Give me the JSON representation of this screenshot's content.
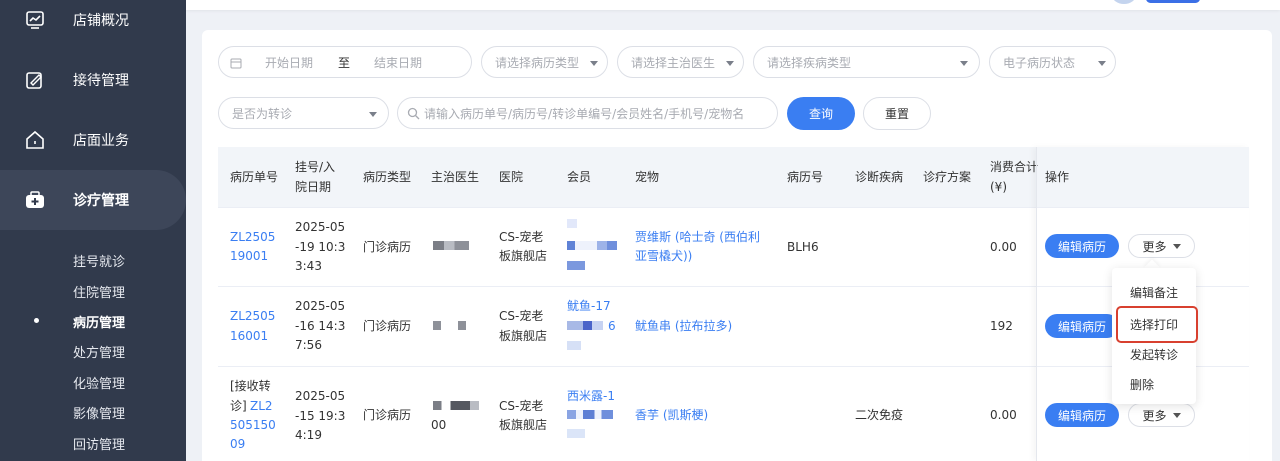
{
  "sidebar": {
    "main_items": [
      {
        "label": "店铺概况",
        "icon": "chart-monitor-icon"
      },
      {
        "label": "接待管理",
        "icon": "clipboard-edit-icon"
      },
      {
        "label": "店面业务",
        "icon": "home-icon"
      },
      {
        "label": "诊疗管理",
        "icon": "medical-kit-icon"
      }
    ],
    "sub_items": [
      "挂号就诊",
      "住院管理",
      "病历管理",
      "处方管理",
      "化验管理",
      "影像管理",
      "回访管理"
    ],
    "active_sub": "病历管理"
  },
  "filters": {
    "start_date": "开始日期",
    "to": "至",
    "end_date": "结束日期",
    "record_type": "请选择病历类型",
    "doctor": "请选择主治医生",
    "disease": "请选择疾病类型",
    "emr_status": "电子病历状态",
    "transfer": "是否为转诊",
    "search_placeholder": "请输入病历单号/病历号/转诊单编号/会员姓名/手机号/宠物名",
    "query_label": "查询",
    "reset_label": "重置"
  },
  "table": {
    "headers": {
      "record_no": "病历单号",
      "reg_date_1": "挂号/入",
      "reg_date_2": "院日期",
      "record_type": "病历类型",
      "doctor": "主治医生",
      "hospital": "医院",
      "member": "会员",
      "pet": "宠物",
      "case_no": "病历号",
      "diagnosis": "诊断疾病",
      "plan": "诊疗方案",
      "total_1": "消费合计",
      "total_2": "(¥)",
      "ops": "操作"
    },
    "rows": [
      {
        "record_no_1": "ZL2505",
        "record_no_2": "19001",
        "date_1": "2025-05",
        "date_2": "-19 10:3",
        "date_3": "3:43",
        "type": "门诊病历",
        "hospital_1": "CS-宠老",
        "hospital_2": "板旗舰店",
        "pet_1": "贾维斯 (哈士奇 (西伯利",
        "pet_2": "亚雪橇犬))",
        "case_no": "BLH6",
        "diagnosis": "",
        "total": "0.00"
      },
      {
        "record_no_1": "ZL2505",
        "record_no_2": "16001",
        "date_1": "2025-05",
        "date_2": "-16 14:3",
        "date_3": "7:56",
        "type": "门诊病历",
        "hospital_1": "CS-宠老",
        "hospital_2": "板旗舰店",
        "member_1": "鱿鱼-17",
        "member_2": "6",
        "pet_1": "鱿鱼串 (拉布拉多)",
        "case_no": "",
        "diagnosis": "",
        "total": "192"
      },
      {
        "prefix": "[接收转",
        "record_no_0": "诊]",
        "record_no_1": "ZL2",
        "record_no_2": "505150",
        "record_no_3": "09",
        "date_1": "2025-05",
        "date_2": "-15 19:3",
        "date_3": "4:19",
        "type": "门诊病历",
        "doctor_2": "00",
        "hospital_1": "CS-宠老",
        "hospital_2": "板旗舰店",
        "member_1": "西米露-1",
        "pet_1": "香芋 (凯斯梗)",
        "diagnosis": "二次免疫",
        "total": "0.00"
      }
    ],
    "edit_label": "编辑病历",
    "more_label": "更多"
  },
  "menu": {
    "items": [
      "编辑备注",
      "选择打印",
      "发起转诊",
      "删除"
    ],
    "highlighted": "选择打印"
  },
  "colors": {
    "sidebar_bg": "#313a4c",
    "primary": "#3a7ef2",
    "highlight_border": "#d8402f"
  }
}
